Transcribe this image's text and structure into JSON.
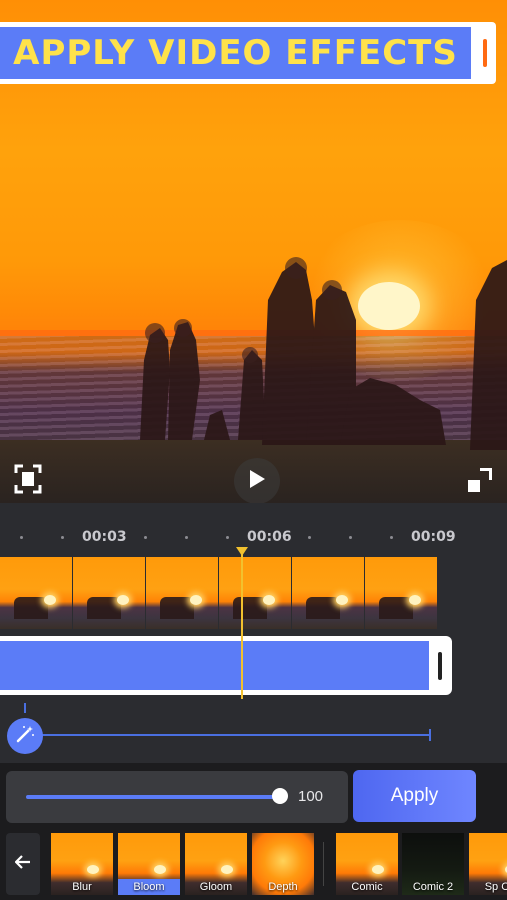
{
  "banner": {
    "title": "APPLY VIDEO EFFECTS"
  },
  "timeline": {
    "time_marks": [
      "00:03",
      "00:06",
      "00:09"
    ]
  },
  "intensity": {
    "value": "100",
    "level_percent": 100
  },
  "apply_label": "Apply",
  "effects": [
    {
      "label": "Blur",
      "selected": false
    },
    {
      "label": "Bloom",
      "selected": true
    },
    {
      "label": "Gloom",
      "selected": false
    },
    {
      "label": "Depth",
      "selected": false
    },
    {
      "label": "Comic",
      "selected": false
    },
    {
      "label": "Comic 2",
      "selected": false
    },
    {
      "label": "Sp Co",
      "selected": false
    }
  ],
  "icons": {
    "fit": "fit-screen-icon",
    "play": "play-icon",
    "fullscreen": "fullscreen-icon",
    "magic": "magic-wand-icon",
    "back": "arrow-left-icon"
  },
  "colors": {
    "accent": "#5b7cf7",
    "banner_text": "#ffe24a",
    "playhead": "#f2c12e",
    "panel": "#2b2c30"
  }
}
